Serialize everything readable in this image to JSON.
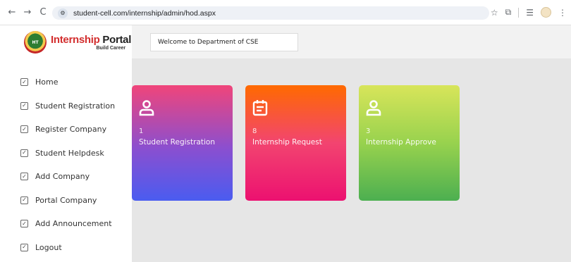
{
  "browser": {
    "url": "student-cell.com/internship/admin/hod.aspx",
    "back_glyph": "←",
    "forward_glyph": "→",
    "reload_glyph": "C",
    "site_info_glyph": "⚙",
    "bookmark_glyph": "☆",
    "extensions_glyph": "⧉",
    "reading_list_glyph": "☰",
    "menu_glyph": "⋮"
  },
  "logo": {
    "title_accent": "Internship",
    "title_rest": " Portal",
    "subtitle": "Build Career",
    "emblem_text": "HT"
  },
  "sidebar": {
    "check_glyph": "✓",
    "items": [
      {
        "label": "Home"
      },
      {
        "label": "Student Registration"
      },
      {
        "label": "Register Company"
      },
      {
        "label": "Student Helpdesk"
      },
      {
        "label": "Add Company"
      },
      {
        "label": "Portal Company"
      },
      {
        "label": "Add Announcement"
      },
      {
        "label": "Logout"
      }
    ]
  },
  "header": {
    "welcome": "Welcome to Department of CSE"
  },
  "cards": [
    {
      "count": "1",
      "label": "Student Registration",
      "icon": "user-icon"
    },
    {
      "count": "8",
      "label": "Internship Request",
      "icon": "calendar-icon"
    },
    {
      "count": "3",
      "label": "Internship Approve",
      "icon": "user-icon"
    }
  ]
}
